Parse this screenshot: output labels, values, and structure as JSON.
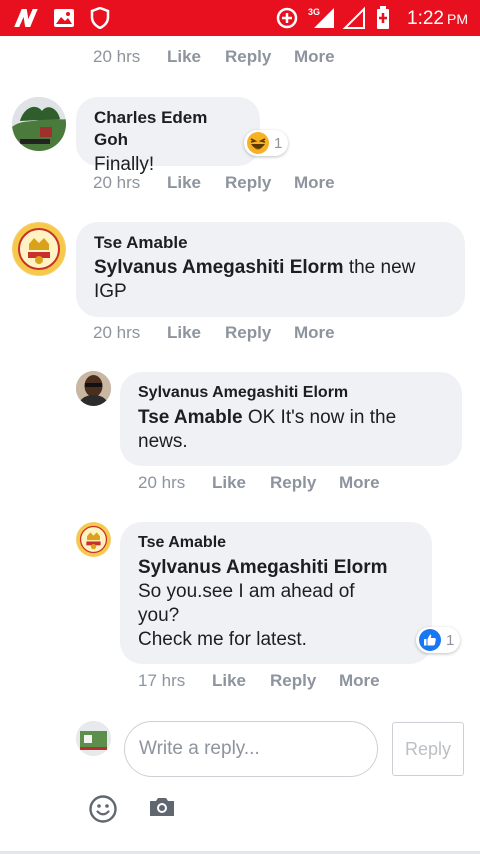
{
  "status_bar": {
    "time": "1:22",
    "ampm": "PM",
    "network": "3G",
    "color": "#e8101e"
  },
  "top_meta": {
    "time": "20 hrs",
    "like": "Like",
    "reply": "Reply",
    "more": "More"
  },
  "comments": [
    {
      "author": "Charles Edem Goh",
      "text": "Finally!",
      "reaction": {
        "icon": "haha-emoji-icon",
        "count": "1"
      },
      "meta": {
        "time": "20 hrs",
        "like": "Like",
        "reply": "Reply",
        "more": "More"
      }
    },
    {
      "author": "Tse Amable",
      "mention": "Sylvanus Amegashiti Elorm",
      "text_line1": " the new",
      "text_line2": "IGP",
      "meta": {
        "time": "20 hrs",
        "like": "Like",
        "reply": "Reply",
        "more": "More"
      }
    },
    {
      "author": "Sylvanus Amegashiti Elorm",
      "mention": "Tse Amable",
      "text_line1": " OK It's now in the",
      "text_line2": "news.",
      "meta": {
        "time": "20 hrs",
        "like": "Like",
        "reply": "Reply",
        "more": "More"
      }
    },
    {
      "author": "Tse Amable",
      "mention": "Sylvanus Amegashiti Elorm",
      "text_line1": "So you.see I am ahead of",
      "text_line2": "you?",
      "text_line3": "Check me for latest.",
      "reaction": {
        "icon": "like-thumb-icon",
        "count": "1"
      },
      "meta": {
        "time": "17 hrs",
        "like": "Like",
        "reply": "Reply",
        "more": "More"
      }
    }
  ],
  "composer": {
    "placeholder": "Write a reply...",
    "reply_label": "Reply"
  }
}
